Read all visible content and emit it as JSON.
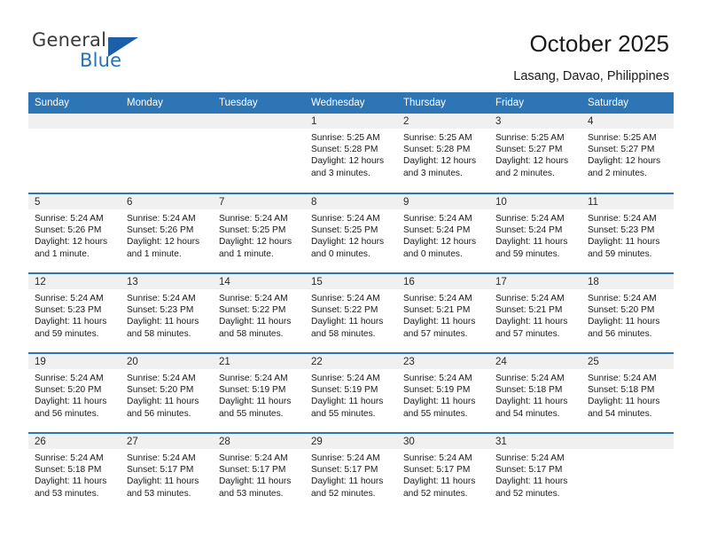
{
  "brand": {
    "name_top": "General",
    "name_bottom": "Blue",
    "triangle_color": "#1b5fa8",
    "blue_color": "#2572b8"
  },
  "header": {
    "title": "October 2025",
    "subtitle": "Lasang, Davao, Philippines"
  },
  "theme": {
    "header_blue": "#2e75b6",
    "daynum_band": "#f0f0f0",
    "text": "#1a1a1a"
  },
  "labels": {
    "sunrise_prefix": "Sunrise:",
    "sunset_prefix": "Sunset:",
    "daylight_prefix": "Daylight:"
  },
  "weekday_headers": [
    "Sunday",
    "Monday",
    "Tuesday",
    "Wednesday",
    "Thursday",
    "Friday",
    "Saturday"
  ],
  "weeks": [
    [
      {
        "empty": true
      },
      {
        "empty": true
      },
      {
        "empty": true
      },
      {
        "day": "1",
        "sunrise": "Sunrise: 5:25 AM",
        "sunset": "Sunset: 5:28 PM",
        "daylight_line1": "Daylight: 12 hours",
        "daylight_line2": "and 3 minutes."
      },
      {
        "day": "2",
        "sunrise": "Sunrise: 5:25 AM",
        "sunset": "Sunset: 5:28 PM",
        "daylight_line1": "Daylight: 12 hours",
        "daylight_line2": "and 3 minutes."
      },
      {
        "day": "3",
        "sunrise": "Sunrise: 5:25 AM",
        "sunset": "Sunset: 5:27 PM",
        "daylight_line1": "Daylight: 12 hours",
        "daylight_line2": "and 2 minutes."
      },
      {
        "day": "4",
        "sunrise": "Sunrise: 5:25 AM",
        "sunset": "Sunset: 5:27 PM",
        "daylight_line1": "Daylight: 12 hours",
        "daylight_line2": "and 2 minutes."
      }
    ],
    [
      {
        "day": "5",
        "sunrise": "Sunrise: 5:24 AM",
        "sunset": "Sunset: 5:26 PM",
        "daylight_line1": "Daylight: 12 hours",
        "daylight_line2": "and 1 minute."
      },
      {
        "day": "6",
        "sunrise": "Sunrise: 5:24 AM",
        "sunset": "Sunset: 5:26 PM",
        "daylight_line1": "Daylight: 12 hours",
        "daylight_line2": "and 1 minute."
      },
      {
        "day": "7",
        "sunrise": "Sunrise: 5:24 AM",
        "sunset": "Sunset: 5:25 PM",
        "daylight_line1": "Daylight: 12 hours",
        "daylight_line2": "and 1 minute."
      },
      {
        "day": "8",
        "sunrise": "Sunrise: 5:24 AM",
        "sunset": "Sunset: 5:25 PM",
        "daylight_line1": "Daylight: 12 hours",
        "daylight_line2": "and 0 minutes."
      },
      {
        "day": "9",
        "sunrise": "Sunrise: 5:24 AM",
        "sunset": "Sunset: 5:24 PM",
        "daylight_line1": "Daylight: 12 hours",
        "daylight_line2": "and 0 minutes."
      },
      {
        "day": "10",
        "sunrise": "Sunrise: 5:24 AM",
        "sunset": "Sunset: 5:24 PM",
        "daylight_line1": "Daylight: 11 hours",
        "daylight_line2": "and 59 minutes."
      },
      {
        "day": "11",
        "sunrise": "Sunrise: 5:24 AM",
        "sunset": "Sunset: 5:23 PM",
        "daylight_line1": "Daylight: 11 hours",
        "daylight_line2": "and 59 minutes."
      }
    ],
    [
      {
        "day": "12",
        "sunrise": "Sunrise: 5:24 AM",
        "sunset": "Sunset: 5:23 PM",
        "daylight_line1": "Daylight: 11 hours",
        "daylight_line2": "and 59 minutes."
      },
      {
        "day": "13",
        "sunrise": "Sunrise: 5:24 AM",
        "sunset": "Sunset: 5:23 PM",
        "daylight_line1": "Daylight: 11 hours",
        "daylight_line2": "and 58 minutes."
      },
      {
        "day": "14",
        "sunrise": "Sunrise: 5:24 AM",
        "sunset": "Sunset: 5:22 PM",
        "daylight_line1": "Daylight: 11 hours",
        "daylight_line2": "and 58 minutes."
      },
      {
        "day": "15",
        "sunrise": "Sunrise: 5:24 AM",
        "sunset": "Sunset: 5:22 PM",
        "daylight_line1": "Daylight: 11 hours",
        "daylight_line2": "and 58 minutes."
      },
      {
        "day": "16",
        "sunrise": "Sunrise: 5:24 AM",
        "sunset": "Sunset: 5:21 PM",
        "daylight_line1": "Daylight: 11 hours",
        "daylight_line2": "and 57 minutes."
      },
      {
        "day": "17",
        "sunrise": "Sunrise: 5:24 AM",
        "sunset": "Sunset: 5:21 PM",
        "daylight_line1": "Daylight: 11 hours",
        "daylight_line2": "and 57 minutes."
      },
      {
        "day": "18",
        "sunrise": "Sunrise: 5:24 AM",
        "sunset": "Sunset: 5:20 PM",
        "daylight_line1": "Daylight: 11 hours",
        "daylight_line2": "and 56 minutes."
      }
    ],
    [
      {
        "day": "19",
        "sunrise": "Sunrise: 5:24 AM",
        "sunset": "Sunset: 5:20 PM",
        "daylight_line1": "Daylight: 11 hours",
        "daylight_line2": "and 56 minutes."
      },
      {
        "day": "20",
        "sunrise": "Sunrise: 5:24 AM",
        "sunset": "Sunset: 5:20 PM",
        "daylight_line1": "Daylight: 11 hours",
        "daylight_line2": "and 56 minutes."
      },
      {
        "day": "21",
        "sunrise": "Sunrise: 5:24 AM",
        "sunset": "Sunset: 5:19 PM",
        "daylight_line1": "Daylight: 11 hours",
        "daylight_line2": "and 55 minutes."
      },
      {
        "day": "22",
        "sunrise": "Sunrise: 5:24 AM",
        "sunset": "Sunset: 5:19 PM",
        "daylight_line1": "Daylight: 11 hours",
        "daylight_line2": "and 55 minutes."
      },
      {
        "day": "23",
        "sunrise": "Sunrise: 5:24 AM",
        "sunset": "Sunset: 5:19 PM",
        "daylight_line1": "Daylight: 11 hours",
        "daylight_line2": "and 55 minutes."
      },
      {
        "day": "24",
        "sunrise": "Sunrise: 5:24 AM",
        "sunset": "Sunset: 5:18 PM",
        "daylight_line1": "Daylight: 11 hours",
        "daylight_line2": "and 54 minutes."
      },
      {
        "day": "25",
        "sunrise": "Sunrise: 5:24 AM",
        "sunset": "Sunset: 5:18 PM",
        "daylight_line1": "Daylight: 11 hours",
        "daylight_line2": "and 54 minutes."
      }
    ],
    [
      {
        "day": "26",
        "sunrise": "Sunrise: 5:24 AM",
        "sunset": "Sunset: 5:18 PM",
        "daylight_line1": "Daylight: 11 hours",
        "daylight_line2": "and 53 minutes."
      },
      {
        "day": "27",
        "sunrise": "Sunrise: 5:24 AM",
        "sunset": "Sunset: 5:17 PM",
        "daylight_line1": "Daylight: 11 hours",
        "daylight_line2": "and 53 minutes."
      },
      {
        "day": "28",
        "sunrise": "Sunrise: 5:24 AM",
        "sunset": "Sunset: 5:17 PM",
        "daylight_line1": "Daylight: 11 hours",
        "daylight_line2": "and 53 minutes."
      },
      {
        "day": "29",
        "sunrise": "Sunrise: 5:24 AM",
        "sunset": "Sunset: 5:17 PM",
        "daylight_line1": "Daylight: 11 hours",
        "daylight_line2": "and 52 minutes."
      },
      {
        "day": "30",
        "sunrise": "Sunrise: 5:24 AM",
        "sunset": "Sunset: 5:17 PM",
        "daylight_line1": "Daylight: 11 hours",
        "daylight_line2": "and 52 minutes."
      },
      {
        "day": "31",
        "sunrise": "Sunrise: 5:24 AM",
        "sunset": "Sunset: 5:17 PM",
        "daylight_line1": "Daylight: 11 hours",
        "daylight_line2": "and 52 minutes."
      },
      {
        "empty": true
      }
    ]
  ]
}
